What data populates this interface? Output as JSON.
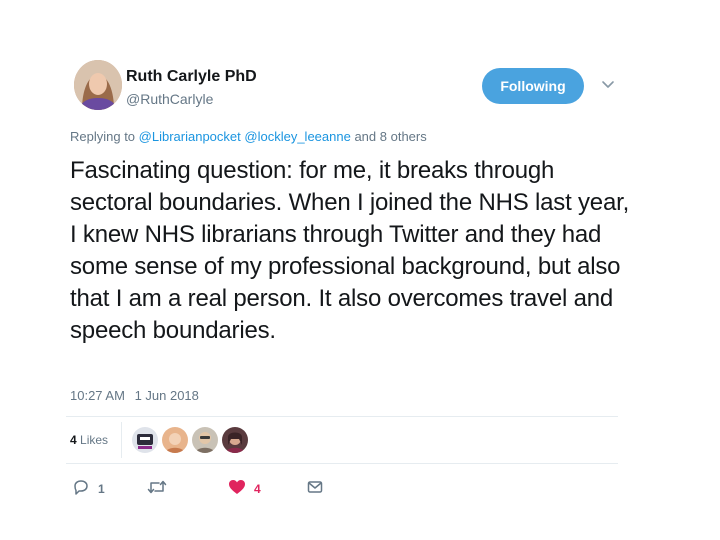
{
  "author": {
    "display_name": "Ruth Carlyle PhD",
    "handle": "@RuthCarlyle"
  },
  "follow_button": {
    "label": "Following"
  },
  "reply_context": {
    "prefix": "Replying to",
    "mentions": [
      "@Librarianpocket",
      "@lockley_leeanne"
    ],
    "suffix": "and 8 others"
  },
  "tweet": {
    "text": "Fascinating question: for me, it breaks through sectoral boundaries. When I joined the NHS last year, I knew NHS librarians through Twitter and they had some sense of my professional background, but also that I am a real person. It also overcomes travel and speech boundaries.",
    "time": "10:27 AM",
    "date": "1 Jun 2018"
  },
  "stats": {
    "likes_count": "4",
    "likes_label": "Likes"
  },
  "actions": {
    "reply_count": "1",
    "retweet_count": "",
    "like_count": "4"
  },
  "colors": {
    "accent": "#4aa3df",
    "link": "#1b95e0",
    "like": "#e0245e",
    "muted": "#657786"
  }
}
